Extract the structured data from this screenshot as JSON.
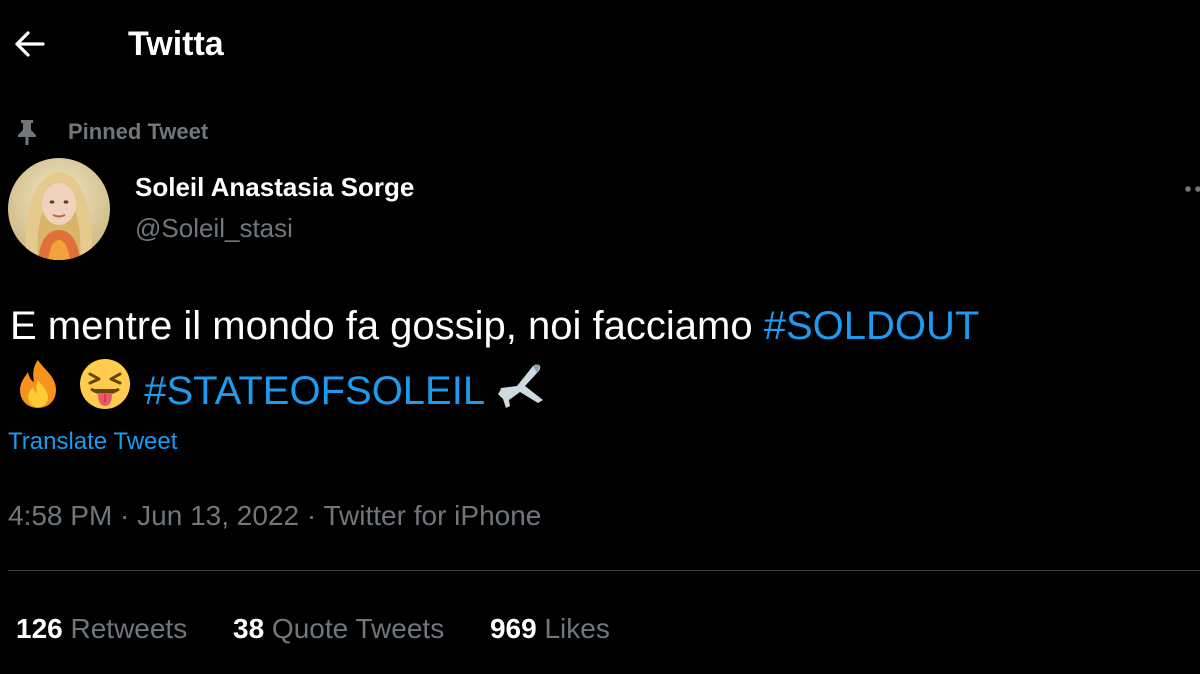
{
  "header": {
    "back_icon": "arrow-left-icon",
    "title": "Twitta"
  },
  "pinned": {
    "icon": "pin-icon",
    "label": "Pinned Tweet"
  },
  "author": {
    "display_name": "Soleil Anastasia Sorge",
    "handle": "@Soleil_stasi",
    "avatar": "profile-photo"
  },
  "tweet": {
    "line1_text": "E mentre il mondo fa gossip, noi facciamo ",
    "hashtag1": "#SOLDOUT",
    "emoji1": "fire-emoji",
    "emoji2": "squinting-face-with-tongue-emoji",
    "hashtag2": "#STATEOFSOLEIL",
    "emoji3": "airplane-emoji",
    "translate_label": "Translate Tweet"
  },
  "meta": {
    "time": "4:58 PM",
    "separator": " · ",
    "date": "Jun 13, 2022",
    "source": "Twitter for iPhone"
  },
  "stats": {
    "retweets_count": "126",
    "retweets_label": " Retweets",
    "quotes_count": "38",
    "quotes_label": " Quote Tweets",
    "likes_count": "969",
    "likes_label": " Likes"
  },
  "colors": {
    "background": "#000000",
    "accent": "#1d9bf0",
    "secondary_text": "#71767b",
    "primary_text": "#ffffff"
  }
}
